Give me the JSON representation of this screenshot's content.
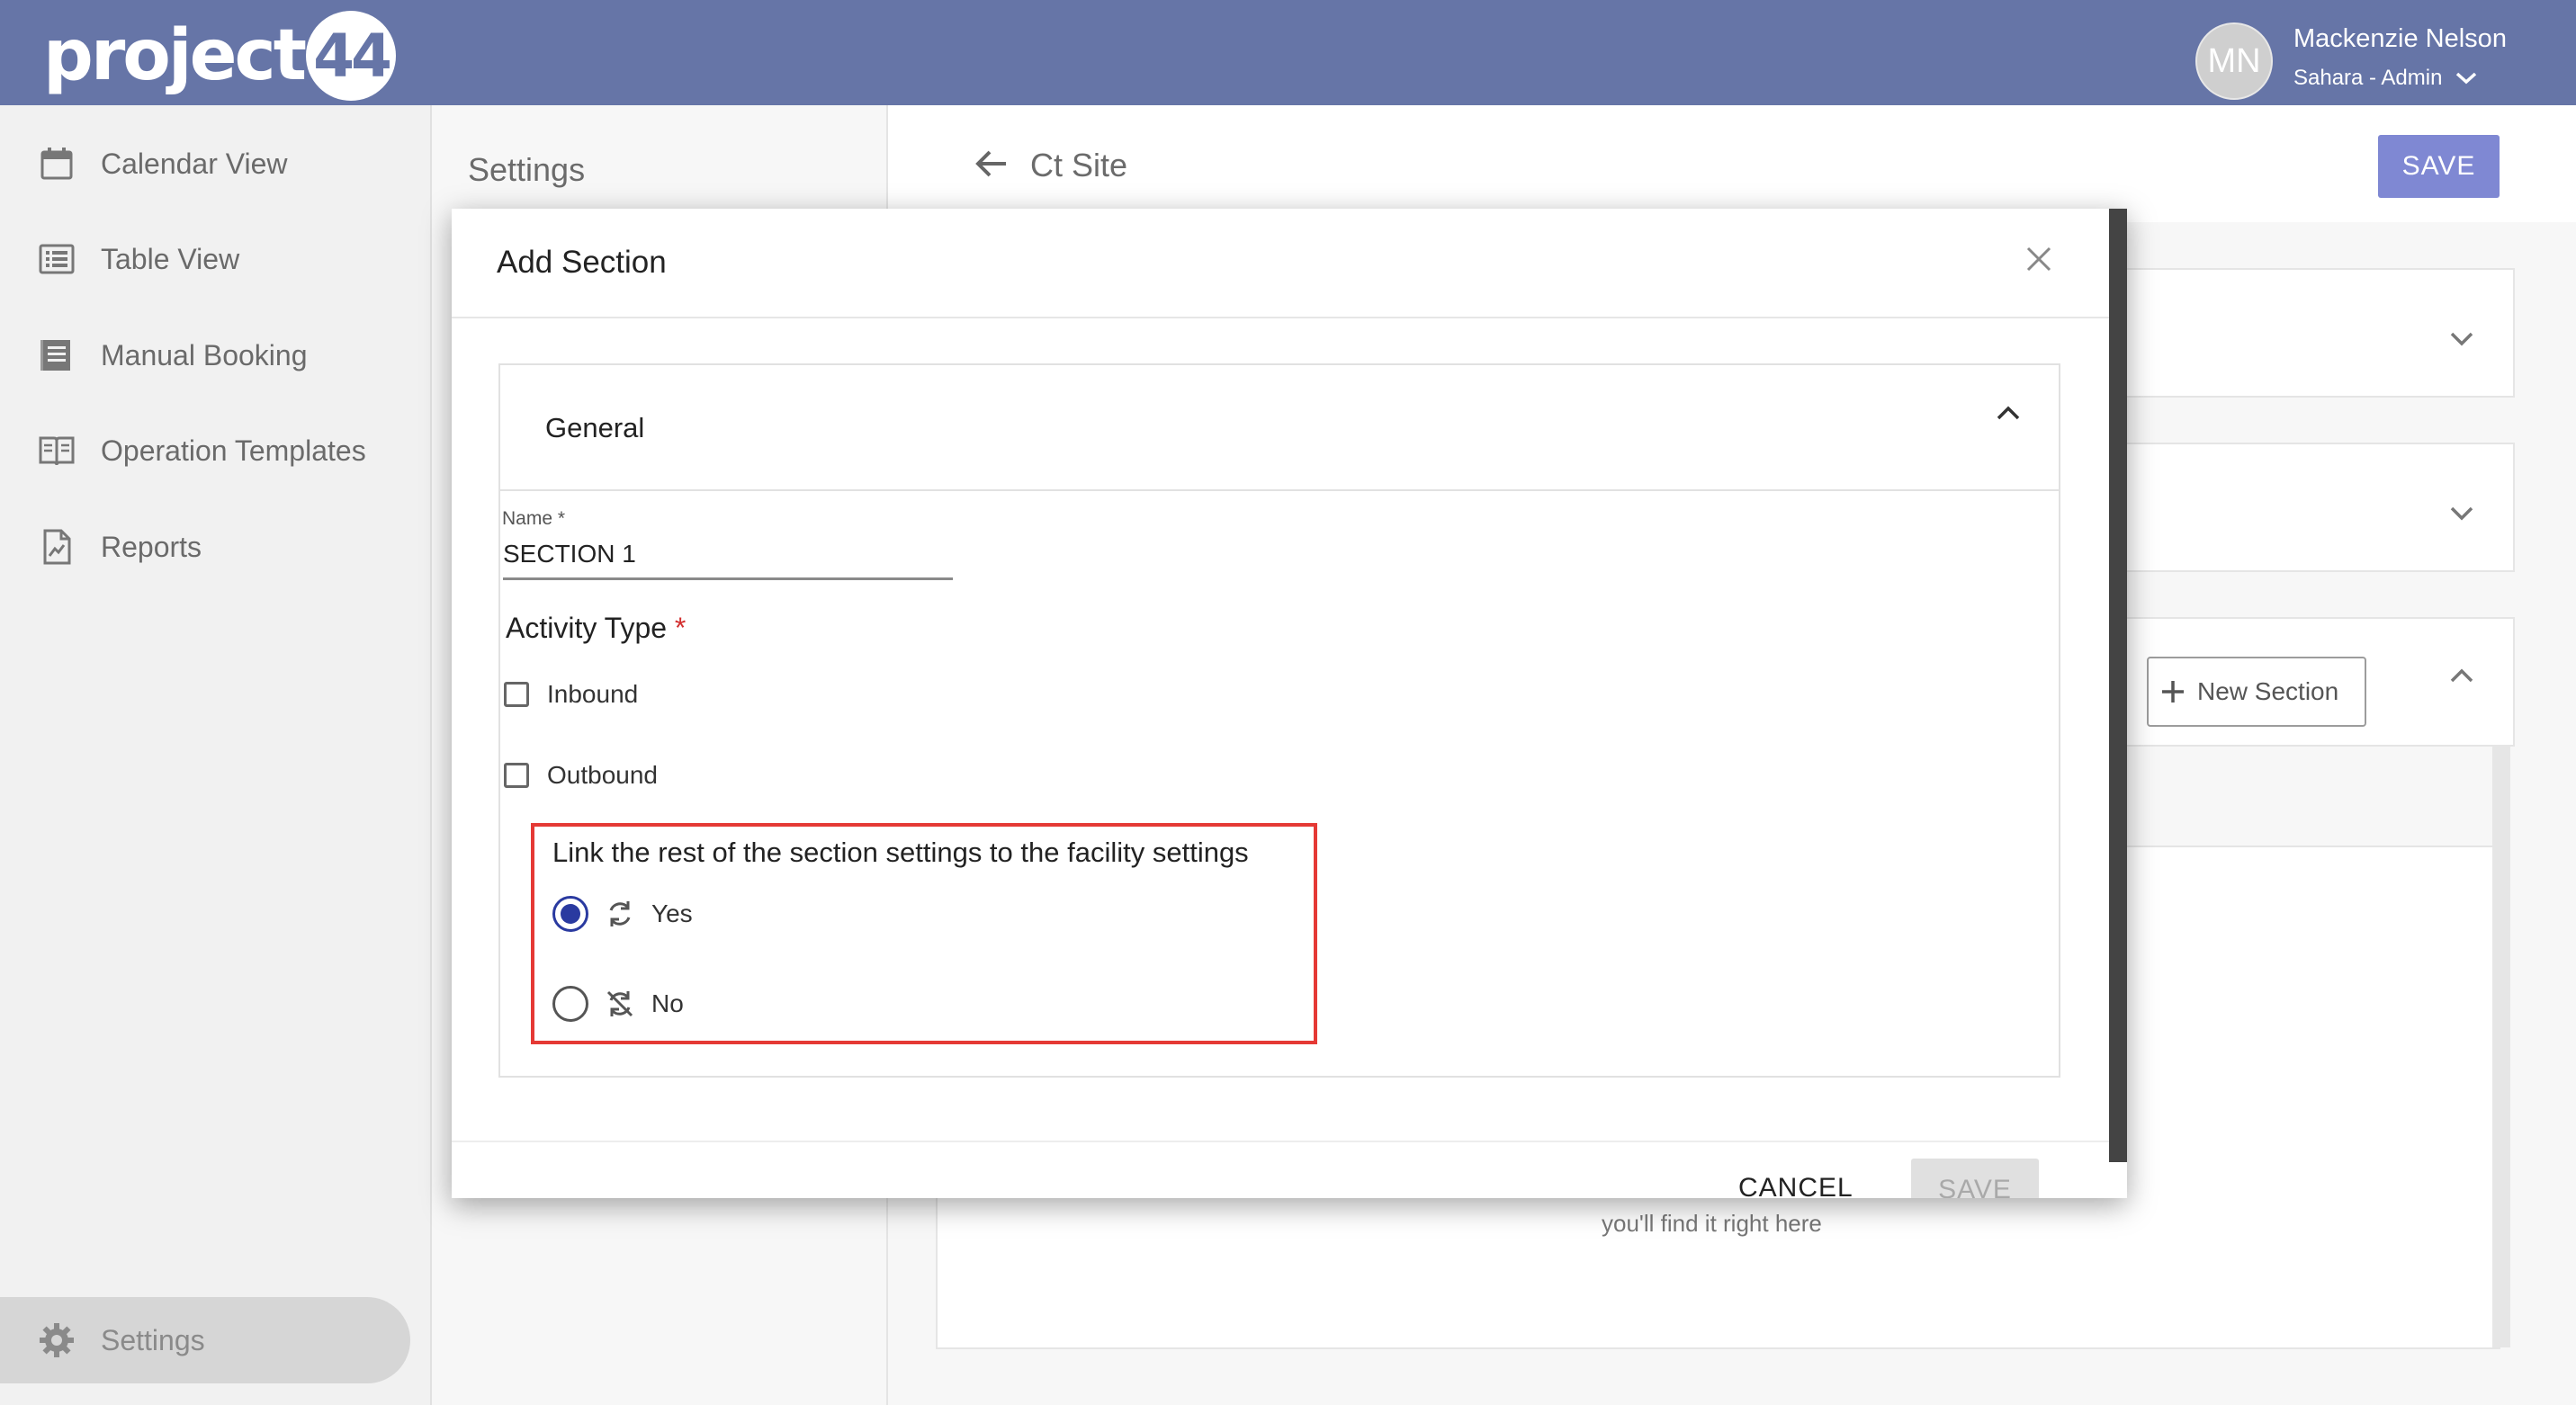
{
  "brand": {
    "logo_text": "project",
    "logo_badge": "44"
  },
  "user": {
    "initials": "MN",
    "name": "Mackenzie Nelson",
    "org": "Sahara - Admin"
  },
  "sidebar": {
    "items": [
      {
        "label": "Calendar View",
        "icon": "calendar-icon"
      },
      {
        "label": "Table View",
        "icon": "list-icon"
      },
      {
        "label": "Manual Booking",
        "icon": "booking-icon"
      },
      {
        "label": "Operation Templates",
        "icon": "book-icon"
      },
      {
        "label": "Reports",
        "icon": "report-icon"
      }
    ],
    "settings_label": "Settings"
  },
  "settings_panel": {
    "title": "Settings"
  },
  "main": {
    "title": "Ct Site",
    "save_label": "SAVE",
    "new_section_label": "New Section",
    "empty_hint": "you'll find it right here"
  },
  "modal": {
    "title": "Add Section",
    "section_title": "General",
    "name_label": "Name *",
    "name_value": "SECTION 1",
    "activity_label": "Activity Type",
    "activity_required": "*",
    "inbound_label": "Inbound",
    "outbound_label": "Outbound",
    "link_label": "Link the rest of the section settings to the facility settings",
    "yes_label": "Yes",
    "no_label": "No",
    "cancel_label": "CANCEL",
    "save_label": "SAVE"
  },
  "colors": {
    "header": "#6675a7",
    "accent": "#2a3aa0",
    "save_button": "#7f88d3",
    "highlight": "#e53935"
  }
}
